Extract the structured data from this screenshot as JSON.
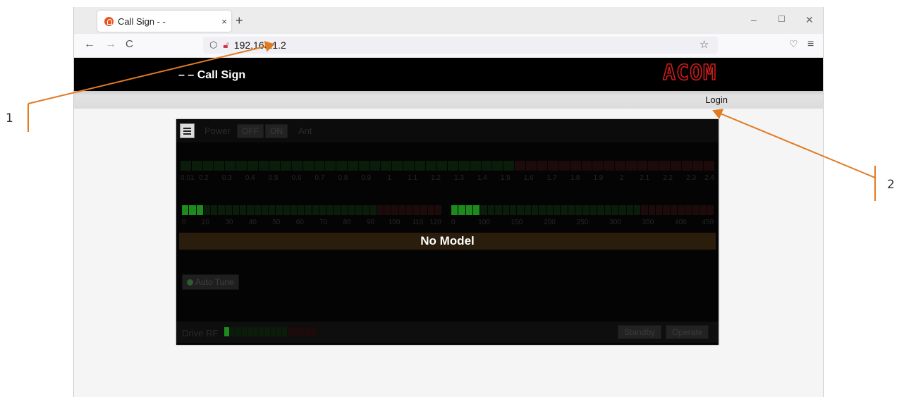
{
  "annotations": {
    "label_1": "1",
    "label_2": "2",
    "arrow_color": "#e07b24"
  },
  "browser": {
    "tab_title": "Call Sign - -",
    "tab_close": "×",
    "new_tab": "+",
    "url": "192.168.1.2",
    "window_controls": {
      "minimize": "–",
      "maximize": "☐",
      "close": "✕"
    },
    "nav": {
      "back": "←",
      "forward": "→",
      "reload": "C",
      "bookmark": "☆",
      "pocket": "♡",
      "menu": "≡"
    }
  },
  "app": {
    "header_title": "– – Call Sign",
    "logo": "ACOM",
    "login": "Login",
    "brand_color": "#d81b1b",
    "power_label": "Power",
    "off_label": "OFF",
    "on_label": "ON",
    "ant_label": "Ant",
    "meter1_ticks": [
      "0.01",
      "0.2",
      "0.3",
      "0.4",
      "0.5",
      "0.6",
      "0.7",
      "0.8",
      "0.9",
      "1",
      "1.1",
      "1.2",
      "1.3",
      "1.4",
      "1.5",
      "1.6",
      "1.7",
      "1.8",
      "1.9",
      "2",
      "2.1",
      "2.2",
      "2.3",
      "2.4"
    ],
    "meter2_ticks": [
      "0",
      "20",
      "30",
      "40",
      "50",
      "60",
      "70",
      "80",
      "90",
      "100",
      "110",
      "120"
    ],
    "meter3_ticks": [
      "0",
      "100",
      "150",
      "200",
      "250",
      "300",
      "350",
      "400",
      "450"
    ],
    "model_text": "No Model",
    "auto_tune_label": "Auto Tune",
    "drive_label": "Drive RF",
    "standby_label": "Standby",
    "operate_label": "Operate"
  }
}
